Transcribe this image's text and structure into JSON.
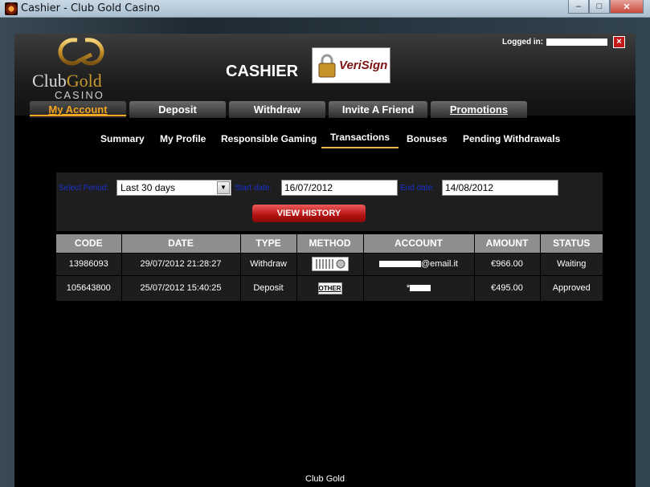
{
  "window": {
    "title": "Cashier - Club Gold Casino",
    "minimize": "–",
    "maximize": "□",
    "close": "✕"
  },
  "logo": {
    "club": "Club",
    "gold": "Gold",
    "casino": "CASINO"
  },
  "header": {
    "title": "CASHIER",
    "verisign": "VeriSign",
    "logged_in_label": "Logged in:",
    "close": "×"
  },
  "topnav": [
    "My Account",
    "Deposit",
    "Withdraw",
    "Invite A Friend",
    "Promotions"
  ],
  "subnav": [
    "Summary",
    "My Profile",
    "Responsible Gaming",
    "Transactions",
    "Bonuses",
    "Pending Withdrawals"
  ],
  "filter": {
    "period_label": "Select Period:",
    "period_value": "Last 30 days",
    "start_label": "Start date:",
    "start_value": "16/07/2012",
    "end_label": "End date:",
    "end_value": "14/08/2012",
    "button": "VIEW HISTORY"
  },
  "table": {
    "headers": [
      "CODE",
      "DATE",
      "TYPE",
      "METHOD",
      "ACCOUNT",
      "AMOUNT",
      "STATUS"
    ],
    "rows": [
      {
        "code": "13986093",
        "date": "29/07/2012 21:28:27",
        "type": "Withdraw",
        "method": "bank-transfer-icon",
        "account": "@email.it",
        "amount": "€966.00",
        "status": "Waiting"
      },
      {
        "code": "105643800",
        "date": "25/07/2012 15:40:25",
        "type": "Deposit",
        "method": "OTHER",
        "account": "*",
        "amount": "€495.00",
        "status": "Approved"
      }
    ]
  },
  "footer": "Club Gold",
  "colors": {
    "accent": "#f2a421",
    "button_red": "#b51212",
    "label_blue": "#1a30d0"
  }
}
